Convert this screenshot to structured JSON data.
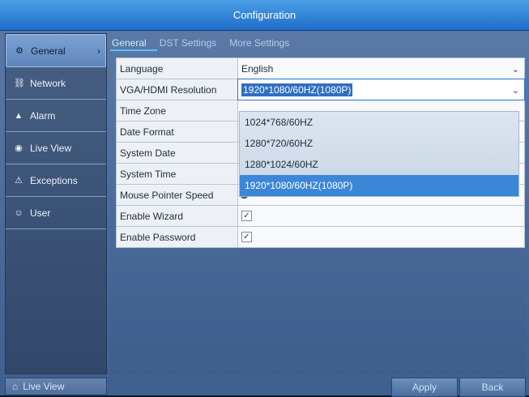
{
  "window": {
    "title": "Configuration"
  },
  "sidebar": {
    "items": [
      {
        "label": "General",
        "icon": "gear-icon",
        "active": true
      },
      {
        "label": "Network",
        "icon": "network-icon",
        "active": false
      },
      {
        "label": "Alarm",
        "icon": "alarm-icon",
        "active": false
      },
      {
        "label": "Live View",
        "icon": "eye-icon",
        "active": false
      },
      {
        "label": "Exceptions",
        "icon": "warning-icon",
        "active": false
      },
      {
        "label": "User",
        "icon": "users-icon",
        "active": false
      }
    ],
    "bottom_button": {
      "label": "Live View",
      "icon": "home-icon"
    }
  },
  "tabs": [
    {
      "label": "General",
      "active": true
    },
    {
      "label": "DST Settings",
      "active": false
    },
    {
      "label": "More Settings",
      "active": false
    }
  ],
  "form": {
    "language": {
      "label": "Language",
      "value": "English"
    },
    "resolution": {
      "label": "VGA/HDMI Resolution",
      "value": "1920*1080/60HZ(1080P)"
    },
    "time_zone": {
      "label": "Time Zone"
    },
    "date_format": {
      "label": "Date Format"
    },
    "system_date": {
      "label": "System Date"
    },
    "system_time": {
      "label": "System Time"
    },
    "mouse_speed": {
      "label": "Mouse Pointer Speed"
    },
    "enable_wizard": {
      "label": "Enable Wizard",
      "checked": true
    },
    "enable_password": {
      "label": "Enable Password",
      "checked": true
    }
  },
  "dropdown": {
    "options": [
      "1024*768/60HZ",
      "1280*720/60HZ",
      "1280*1024/60HZ",
      "1920*1080/60HZ(1080P)"
    ],
    "highlighted_index": 3
  },
  "buttons": {
    "apply": "Apply",
    "back": "Back"
  }
}
